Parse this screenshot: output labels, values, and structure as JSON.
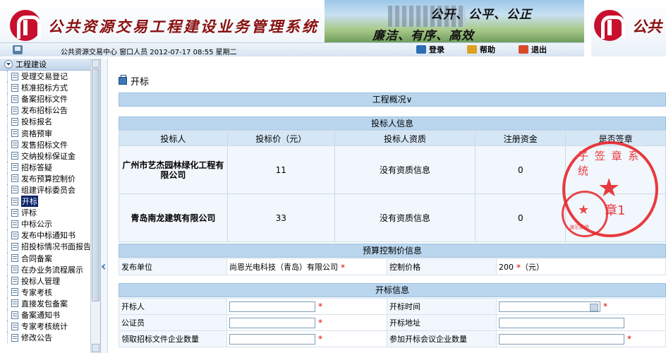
{
  "header": {
    "title": "公共资源交易工程建设业务管理系统",
    "title_right": "公共",
    "slogan_line1": "公开、公平、公正",
    "slogan_line2": "廉洁、有序、高效",
    "user_info": "公共资源交易中心 窗口人员 2012-07-17 08:55 星期二",
    "buttons": {
      "login": "登录",
      "help": "帮助",
      "exit": "退出"
    }
  },
  "sidebar": {
    "root": "工程建设",
    "items": [
      {
        "label": "受理交易登记"
      },
      {
        "label": "核准招标方式"
      },
      {
        "label": "备案招标文件"
      },
      {
        "label": "发布招标公告"
      },
      {
        "label": "投标报名"
      },
      {
        "label": "资格预审"
      },
      {
        "label": "发售招标文件"
      },
      {
        "label": "交纳投标保证金"
      },
      {
        "label": "招标答疑"
      },
      {
        "label": "发布预算控制价"
      },
      {
        "label": "组建评标委员会"
      },
      {
        "label": "开标"
      },
      {
        "label": "评标"
      },
      {
        "label": "中标公示"
      },
      {
        "label": "发布中标通知书"
      },
      {
        "label": "招投标情况书面报告"
      },
      {
        "label": "合同备案"
      },
      {
        "label": "在办业务流程展示"
      },
      {
        "label": "投标人管理"
      },
      {
        "label": "专家考核"
      },
      {
        "label": "直接发包备案"
      },
      {
        "label": "备案通知书"
      },
      {
        "label": "专家考核统计"
      },
      {
        "label": "修改公告"
      }
    ],
    "active_index": 11
  },
  "main": {
    "page_title": "开标",
    "section_overview": "工程概况∨",
    "section_bidders": "投标人信息",
    "bidder_columns": [
      "投标人",
      "投标价（元）",
      "投标人资质",
      "注册资金",
      "是否签章"
    ],
    "bidders": [
      {
        "name": "广州市艺杰园林绿化工程有限公司",
        "price": "11",
        "qualification": "没有资质信息",
        "capital": "0"
      },
      {
        "name": "青岛南龙建筑有限公司",
        "price": "33",
        "qualification": "没有资质信息",
        "capital": "0"
      }
    ],
    "section_budget": "预算控制价信息",
    "budget": {
      "publisher_label": "发布单位",
      "publisher_value": "尚恩光电科技（青岛）有限公司",
      "control_price_label": "控制价格",
      "control_price_value": "200",
      "unit": "（元）"
    },
    "section_opening": "开标信息",
    "opening": {
      "host_label": "开标人",
      "time_label": "开标时间",
      "notary_label": "公证员",
      "place_label": "开标地址",
      "received_label": "领取招标文件企业数量",
      "attended_label": "参加开标会议企业数量"
    },
    "seal": {
      "text_top": "子 签 章 系 统",
      "text_mid": "章1",
      "text_small": "演示系统"
    },
    "required_mark": "*"
  }
}
